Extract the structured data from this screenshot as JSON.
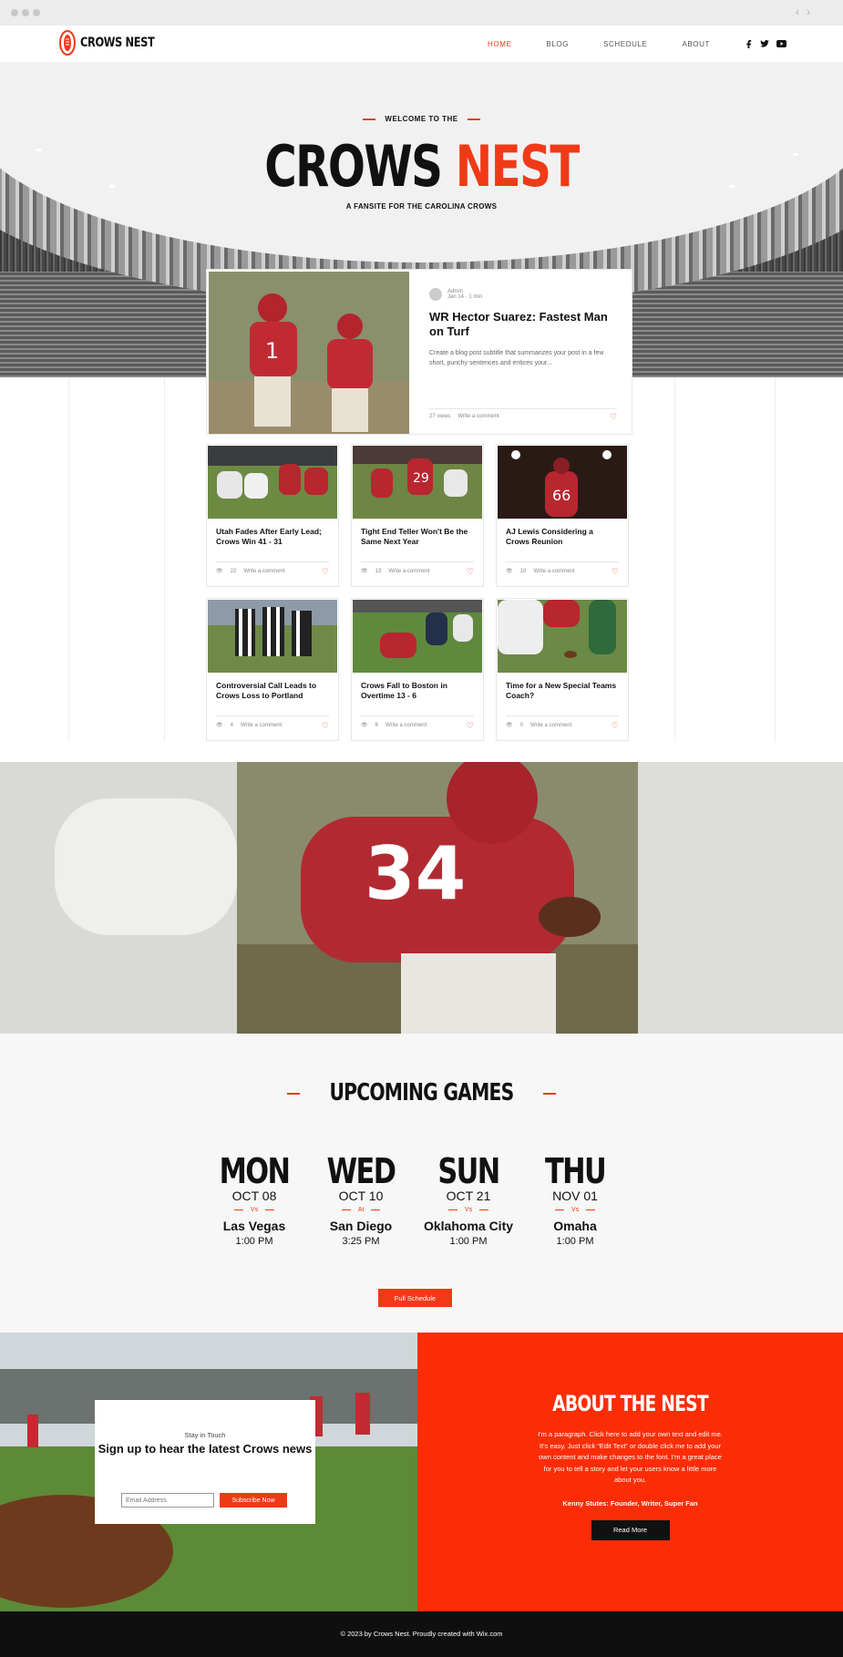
{
  "brand": {
    "name": "CROWS NEST",
    "accent": "#f03a17"
  },
  "nav": {
    "items": [
      "HOME",
      "BLOG",
      "SCHEDULE",
      "ABOUT"
    ],
    "active": "HOME"
  },
  "hero": {
    "welcome": "WELCOME TO THE",
    "title_main": "CROWS",
    "title_accent": "NEST",
    "tagline": "A FANSITE FOR THE CAROLINA CROWS"
  },
  "featured": {
    "author": "Admin",
    "date": "Jan 14",
    "read_time": "1 min",
    "title": "WR Hector Suarez: Fastest Man on Turf",
    "subtitle": "Create a blog post subtitle that summarizes your post in a few short, punchy sentences and entices your...",
    "views": "27 views",
    "comment": "Write a comment"
  },
  "posts": [
    {
      "title": "Utah Fades After Early Lead; Crows Win 41 - 31",
      "views": "22",
      "comment": "Write a comment"
    },
    {
      "title": "Tight End Teller Won't Be the Same Next Year",
      "views": "13",
      "comment": "Write a comment"
    },
    {
      "title": "AJ Lewis Considering a Crows Reunion",
      "views": "10",
      "comment": "Write a comment"
    },
    {
      "title": "Controversial Call Leads to Crows Loss to Portland",
      "views": "4",
      "comment": "Write a comment"
    },
    {
      "title": "Crows Fall to Boston in Overtime 13 - 6",
      "views": "6",
      "comment": "Write a comment"
    },
    {
      "title": "Time for a New Special Teams Coach?",
      "views": "0",
      "comment": "Write a comment"
    }
  ],
  "games": {
    "title": "UPCOMING GAMES",
    "list": [
      {
        "day": "MON",
        "date": "OCT 08",
        "vs": "Vs",
        "opponent": "Las Vegas",
        "time": "1:00 PM"
      },
      {
        "day": "WED",
        "date": "OCT 10",
        "vs": "At",
        "opponent": "San Diego",
        "time": "3:25 PM"
      },
      {
        "day": "SUN",
        "date": "OCT 21",
        "vs": "Vs",
        "opponent": "Oklahoma City",
        "time": "1:00 PM"
      },
      {
        "day": "THU",
        "date": "NOV 01",
        "vs": "Vs",
        "opponent": "Omaha",
        "time": "1:00 PM"
      }
    ],
    "button": "Full Schedule"
  },
  "subscribe": {
    "kicker": "Stay in Touch",
    "title": "Sign up to hear the latest Crows news",
    "placeholder": "Email Address",
    "button": "Subscribe Now"
  },
  "about": {
    "title": "ABOUT THE NEST",
    "body": "I'm a paragraph. Click here to add your own text and edit me. It's easy. Just click “Edit Text” or double click me to add your own content and make changes to the font. I'm a great place for you to tell a story and let your users know a little more about you.",
    "signature": "Kenny Stutes: Founder, Writer, Super Fan",
    "button": "Read More"
  },
  "footer": {
    "text": "© 2023 by Crows Nest. Proudly created with Wix.com"
  }
}
